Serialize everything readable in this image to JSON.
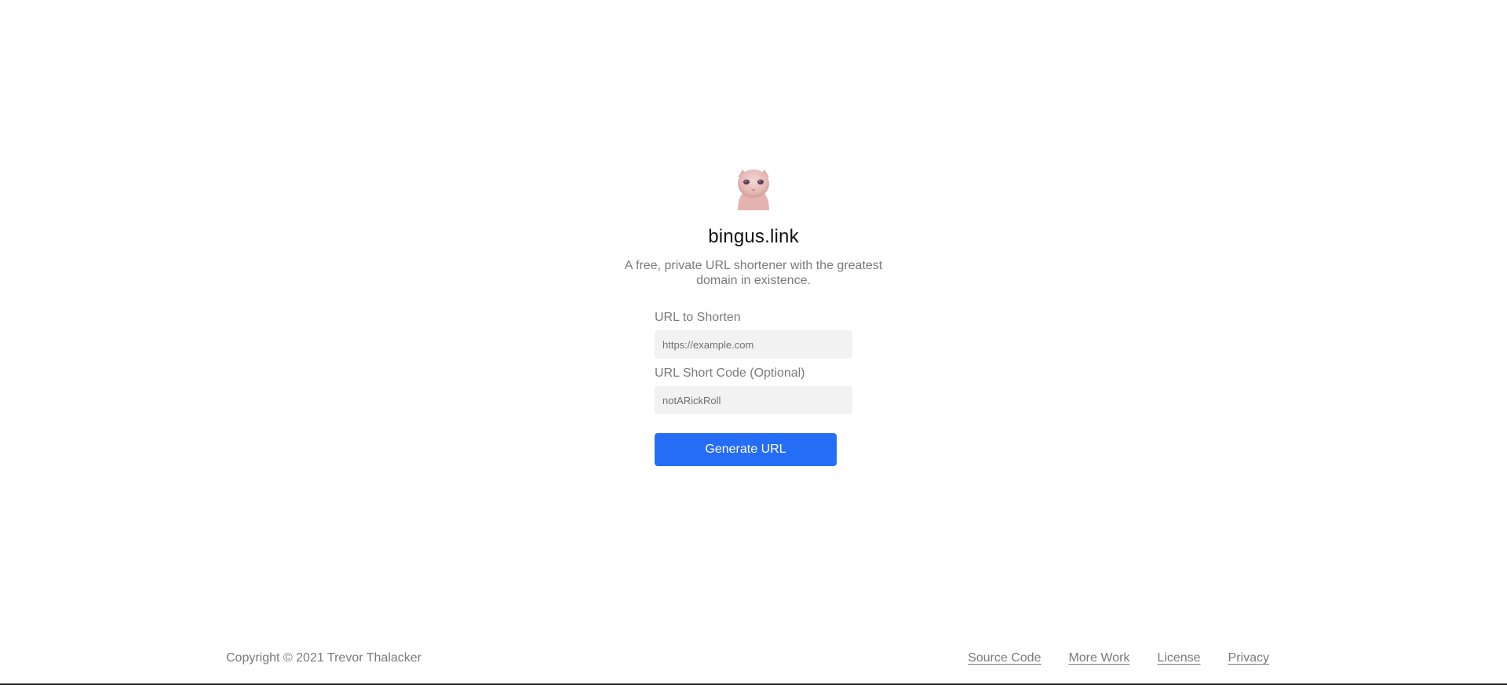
{
  "header": {
    "logo_icon": "bingus-cat-logo-icon",
    "title": "bingus.link",
    "subtitle": "A free, private URL shortener with the greatest domain in existence."
  },
  "form": {
    "url_label": "URL to Shorten",
    "url_placeholder": "https://example.com",
    "url_value": "",
    "code_label": "URL Short Code (Optional)",
    "code_placeholder": "notARickRoll",
    "code_value": "",
    "submit_label": "Generate URL"
  },
  "footer": {
    "copyright": "Copyright © 2021 Trevor Thalacker",
    "links": [
      {
        "label": "Source Code"
      },
      {
        "label": "More Work"
      },
      {
        "label": "License"
      },
      {
        "label": "Privacy"
      }
    ]
  },
  "colors": {
    "accent": "#256df5",
    "muted_text": "#7a7a7a",
    "input_bg": "#f2f2f2"
  }
}
